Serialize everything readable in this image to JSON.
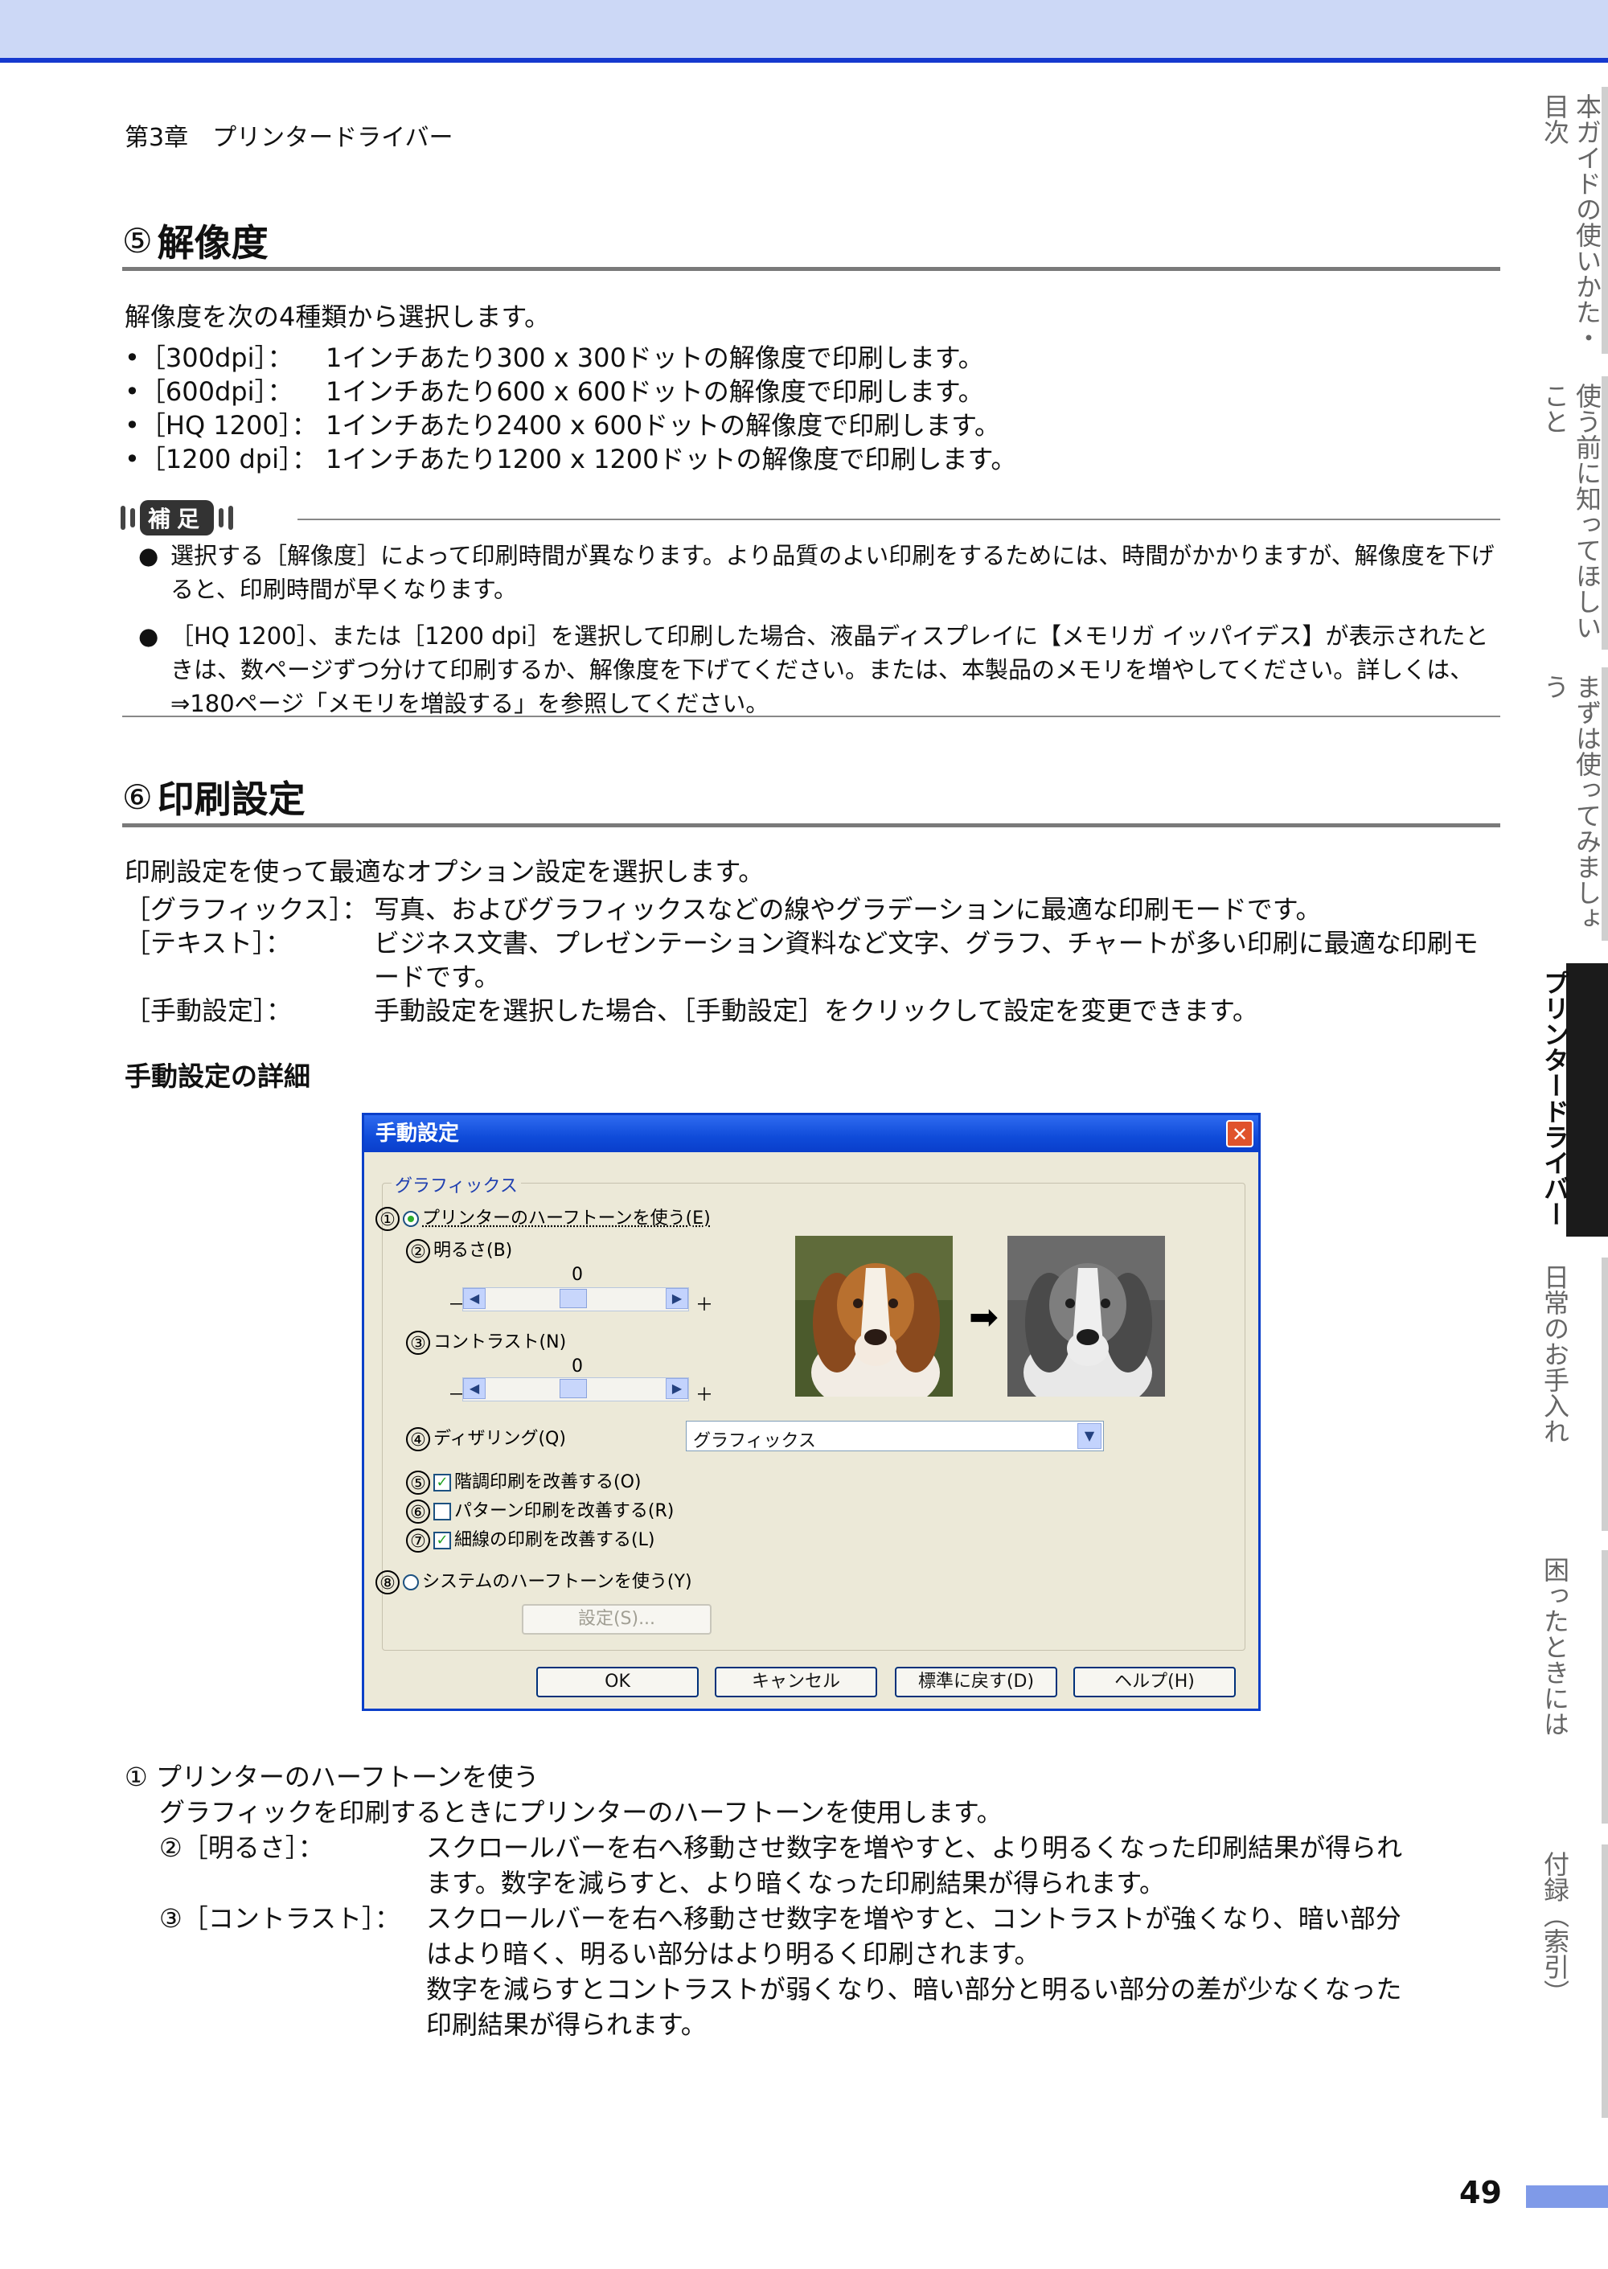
{
  "header": {
    "chapter": "第3章　プリンタードライバー"
  },
  "section5": {
    "num": "⑤",
    "title": "解像度",
    "intro": "解像度を次の4種類から選択します。",
    "items": [
      {
        "tag": "•［300dpi］：",
        "desc": "1インチあたり300 x 300ドットの解像度で印刷します。"
      },
      {
        "tag": "•［600dpi］：",
        "desc": "1インチあたり600 x 600ドットの解像度で印刷します。"
      },
      {
        "tag": "•［HQ 1200］：",
        "desc": "1インチあたり2400 x 600ドットの解像度で印刷します。"
      },
      {
        "tag": "•［1200 dpi］：",
        "desc": "1インチあたり1200 x 1200ドットの解像度で印刷します。"
      }
    ],
    "note_badge": "補足",
    "notes": [
      "選択する［解像度］によって印刷時間が異なります。より品質のよい印刷をするためには、時間がかかりますが、解像度を下げると、印刷時間が早くなります。",
      "［HQ 1200］、または［1200 dpi］を選択して印刷した場合、液晶ディスプレイに【メモリガ イッパイデス】が表示されたときは、数ページずつ分けて印刷するか、解像度を下げてください。または、本製品のメモリを増やしてください。詳しくは、⇒180ページ「メモリを増設する」を参照してください。"
    ]
  },
  "section6": {
    "num": "⑥",
    "title": "印刷設定",
    "intro": "印刷設定を使って最適なオプション設定を選択します。",
    "defs": [
      {
        "term": "［グラフィックス］：",
        "def": "写真、およびグラフィックスなどの線やグラデーションに最適な印刷モードです。"
      },
      {
        "term": "［テキスト］：",
        "def": "ビジネス文書、プレゼンテーション資料など文字、グラフ、チャートが多い印刷に最適な印刷モードです。"
      },
      {
        "term": "［手動設定］：",
        "def": "手動設定を選択した場合、［手動設定］をクリックして設定を変更できます。"
      }
    ],
    "subhead": "手動設定の詳細"
  },
  "dialog": {
    "title": "手動設定",
    "close": "✕",
    "group_label": "グラフィックス",
    "n1": "①",
    "opt_printer_halftone": "プリンターのハーフトーンを使う(E)",
    "n2": "②",
    "brightness_label": "明るさ(B)",
    "brightness_value": "0",
    "n3": "③",
    "contrast_label": "コントラスト(N)",
    "contrast_value": "0",
    "minus": "－",
    "plus": "＋",
    "n4": "④",
    "dithering_label": "ディザリング(Q)",
    "dithering_value": "グラフィックス",
    "n5": "⑤",
    "chk_gradation": "階調印刷を改善する(O)",
    "n6": "⑥",
    "chk_pattern": "パターン印刷を改善する(R)",
    "n7": "⑦",
    "chk_thinline": "細線の印刷を改善する(L)",
    "n8": "⑧",
    "opt_system_halftone": "システムのハーフトーンを使う(Y)",
    "settings_button": "設定(S)...",
    "ok": "OK",
    "cancel": "キャンセル",
    "default": "標準に戻す(D)",
    "help": "ヘルプ(H)",
    "gradation_checked": true,
    "pattern_checked": false,
    "thinline_checked": true
  },
  "explain": {
    "item1": "① プリンターのハーフトーンを使う",
    "item1_desc": "グラフィックを印刷するときにプリンターのハーフトーンを使用します。",
    "item2_term": "②［明るさ］：",
    "item2_line1": "スクロールバーを右へ移動させ数字を増やすと、より明るくなった印刷結果が得られ",
    "item2_line2": "ます。数字を減らすと、より暗くなった印刷結果が得られます。",
    "item3_term": "③［コントラスト］：",
    "item3_line1": "スクロールバーを右へ移動させ数字を増やすと、コントラストが強くなり、暗い部分",
    "item3_line2": "はより暗く、明るい部分はより明るく印刷されます。",
    "item3_line3": "数字を減らすとコントラストが弱くなり、暗い部分と明るい部分の差が少なくなった",
    "item3_line4": "印刷結果が得られます。"
  },
  "sidebar": {
    "tabs": [
      "本ガイドの使いかた・目次",
      "使う前に知ってほしいこと",
      "まずは使ってみましょう",
      "プリンタードライバー",
      "日常のお手入れ",
      "困ったときには",
      "付録（索引）"
    ]
  },
  "page_number": "49"
}
